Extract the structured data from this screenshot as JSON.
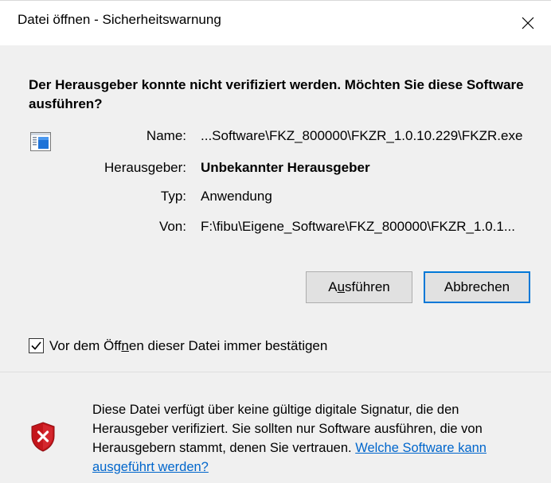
{
  "window": {
    "title": "Datei öffnen - Sicherheitswarnung"
  },
  "headline": "Der Herausgeber konnte nicht verifiziert werden. Möchten Sie diese Software ausführen?",
  "fields": {
    "name_label": "Name:",
    "name_value": "...Software\\FKZ_800000\\FKZR_1.0.10.229\\FKZR.exe",
    "publisher_label": "Herausgeber:",
    "publisher_value": "Unbekannter Herausgeber",
    "type_label": "Typ:",
    "type_value": "Anwendung",
    "from_label": "Von:",
    "from_value": "F:\\fibu\\Eigene_Software\\FKZ_800000\\FKZR_1.0.1..."
  },
  "buttons": {
    "run_pre": "A",
    "run_mnemonic": "u",
    "run_post": "sführen",
    "cancel_label": "Abbrechen"
  },
  "checkbox": {
    "label_pre": "Vor dem Öff",
    "label_mnemonic": "n",
    "label_post": "en dieser Datei immer bestätigen",
    "checked": true
  },
  "footer": {
    "text": "Diese Datei verfügt über keine gültige digitale Signatur, die den Herausgeber verifiziert. Sie sollten nur Software ausführen, die von Herausgebern stammt, denen Sie vertrauen. ",
    "link": "Welche Software kann ausgeführt werden?"
  },
  "icons": {
    "close": "close-icon",
    "app": "application-icon",
    "checkmark": "checkmark-icon",
    "shield": "shield-error-icon"
  },
  "colors": {
    "accent": "#0078d7",
    "link": "#0066cc",
    "shield_red": "#c4161c",
    "panel": "#f0f0f0"
  }
}
